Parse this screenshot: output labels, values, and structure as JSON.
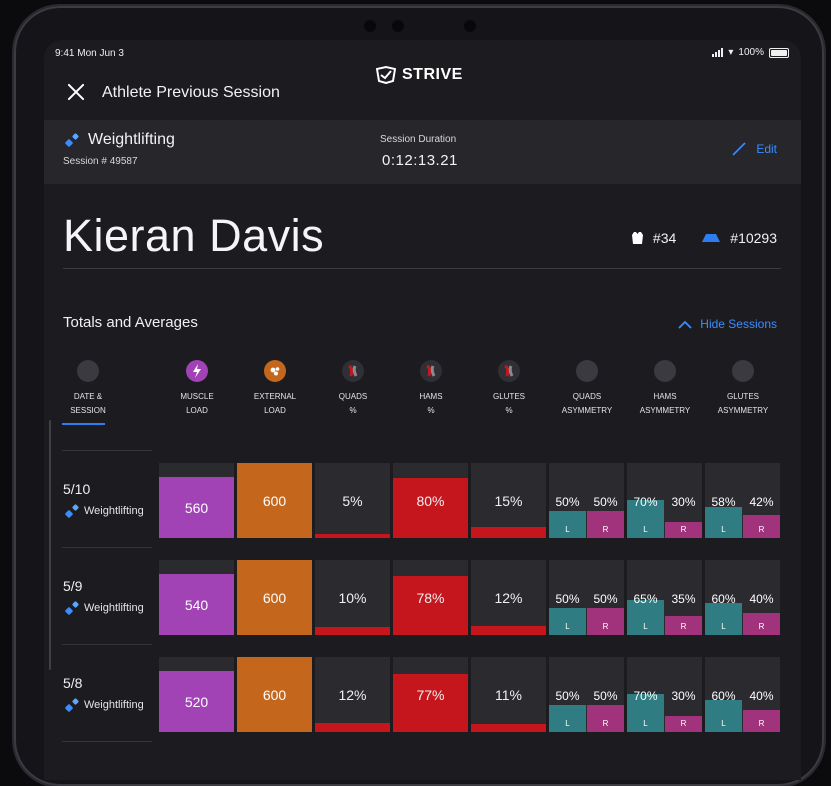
{
  "status": {
    "time": "9:41 Mon Jun 3",
    "battery": "100%"
  },
  "nav": {
    "title": "Athlete Previous Session",
    "brand": "STRIVE"
  },
  "session": {
    "sport": "Weightlifting",
    "number": "Session # 49587",
    "duration_label": "Session Duration",
    "duration": "0:12:13.21",
    "edit": "Edit"
  },
  "athlete": {
    "name": "Kieran Davis",
    "jersey": "#34",
    "device": "#10293"
  },
  "section": {
    "title": "Totals and Averages",
    "toggle": "Hide Sessions"
  },
  "columns": [
    {
      "line1": "DATE &",
      "line2": "SESSION",
      "icon": "circle-icon"
    },
    {
      "line1": "MUSCLE",
      "line2": "LOAD",
      "icon": "lightning-icon"
    },
    {
      "line1": "EXTERNAL",
      "line2": "LOAD",
      "icon": "weight-icon"
    },
    {
      "line1": "QUADS",
      "line2": "%",
      "icon": "quads-icon"
    },
    {
      "line1": "HAMS",
      "line2": "%",
      "icon": "hams-icon"
    },
    {
      "line1": "GLUTES",
      "line2": "%",
      "icon": "glutes-icon"
    },
    {
      "line1": "QUADS",
      "line2": "ASYMMETRY",
      "icon": "circle-icon"
    },
    {
      "line1": "HAMS",
      "line2": "ASYMMETRY",
      "icon": "circle-icon"
    },
    {
      "line1": "GLUTES",
      "line2": "ASYMMETRY",
      "icon": "circle-icon"
    }
  ],
  "colors": {
    "muscle": "#a143b5",
    "external": "#c4661c",
    "red": "#c4161c",
    "teal": "#2f7d82",
    "magenta": "#a1327c",
    "accent": "#3a8dff"
  },
  "asym_labels": {
    "left": "L",
    "right": "R"
  },
  "rows": [
    {
      "date": "5/10",
      "sport": "Weightlifting",
      "muscle": "560",
      "external": "600",
      "quads": "5%",
      "hams": "80%",
      "glutes": "15%",
      "quads_asym": {
        "l": "50%",
        "r": "50%"
      },
      "hams_asym": {
        "l": "70%",
        "r": "30%"
      },
      "glutes_asym": {
        "l": "58%",
        "r": "42%"
      }
    },
    {
      "date": "5/9",
      "sport": "Weightlifting",
      "muscle": "540",
      "external": "600",
      "quads": "10%",
      "hams": "78%",
      "glutes": "12%",
      "quads_asym": {
        "l": "50%",
        "r": "50%"
      },
      "hams_asym": {
        "l": "65%",
        "r": "35%"
      },
      "glutes_asym": {
        "l": "60%",
        "r": "40%"
      }
    },
    {
      "date": "5/8",
      "sport": "Weightlifting",
      "muscle": "520",
      "external": "600",
      "quads": "12%",
      "hams": "77%",
      "glutes": "11%",
      "quads_asym": {
        "l": "50%",
        "r": "50%"
      },
      "hams_asym": {
        "l": "70%",
        "r": "30%"
      },
      "glutes_asym": {
        "l": "60%",
        "r": "40%"
      }
    }
  ]
}
